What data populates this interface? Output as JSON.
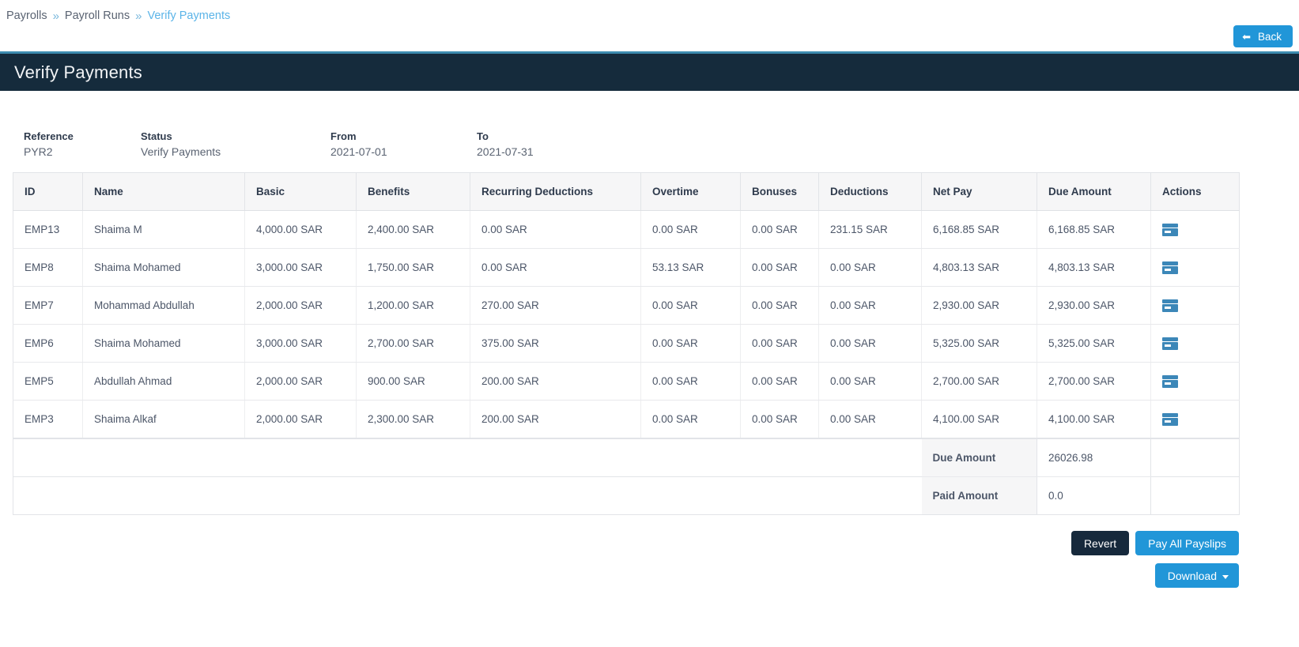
{
  "breadcrumb": {
    "items": [
      {
        "label": "Payrolls",
        "active": false
      },
      {
        "label": "Payroll Runs",
        "active": false
      },
      {
        "label": "Verify Payments",
        "active": true
      }
    ],
    "separator": "»"
  },
  "toolbar": {
    "back_label": "Back",
    "back_icon": "arrow-left-icon"
  },
  "header": {
    "title": "Verify Payments"
  },
  "meta": [
    {
      "label": "Reference",
      "value": "PYR2"
    },
    {
      "label": "Status",
      "value": "Verify Payments"
    },
    {
      "label": "From",
      "value": "2021-07-01"
    },
    {
      "label": "To",
      "value": "2021-07-31"
    }
  ],
  "table": {
    "columns": [
      "ID",
      "Name",
      "Basic",
      "Benefits",
      "Recurring Deductions",
      "Overtime",
      "Bonuses",
      "Deductions",
      "Net Pay",
      "Due Amount",
      "Actions"
    ],
    "rows": [
      {
        "id": "EMP13",
        "name": "Shaima M",
        "basic": "4,000.00 SAR",
        "benefits": "2,400.00 SAR",
        "recurring_deductions": "0.00 SAR",
        "overtime": "0.00 SAR",
        "bonuses": "0.00 SAR",
        "deductions": "231.15 SAR",
        "net_pay": "6,168.85 SAR",
        "due_amount": "6,168.85 SAR",
        "action_icon": "credit-card-icon"
      },
      {
        "id": "EMP8",
        "name": "Shaima Mohamed",
        "basic": "3,000.00 SAR",
        "benefits": "1,750.00 SAR",
        "recurring_deductions": "0.00 SAR",
        "overtime": "53.13 SAR",
        "bonuses": "0.00 SAR",
        "deductions": "0.00 SAR",
        "net_pay": "4,803.13 SAR",
        "due_amount": "4,803.13 SAR",
        "action_icon": "credit-card-icon"
      },
      {
        "id": "EMP7",
        "name": "Mohammad Abdullah",
        "basic": "2,000.00 SAR",
        "benefits": "1,200.00 SAR",
        "recurring_deductions": "270.00 SAR",
        "overtime": "0.00 SAR",
        "bonuses": "0.00 SAR",
        "deductions": "0.00 SAR",
        "net_pay": "2,930.00 SAR",
        "due_amount": "2,930.00 SAR",
        "action_icon": "credit-card-icon"
      },
      {
        "id": "EMP6",
        "name": "Shaima Mohamed",
        "basic": "3,000.00 SAR",
        "benefits": "2,700.00 SAR",
        "recurring_deductions": "375.00 SAR",
        "overtime": "0.00 SAR",
        "bonuses": "0.00 SAR",
        "deductions": "0.00 SAR",
        "net_pay": "5,325.00 SAR",
        "due_amount": "5,325.00 SAR",
        "action_icon": "credit-card-icon"
      },
      {
        "id": "EMP5",
        "name": "Abdullah Ahmad",
        "basic": "2,000.00 SAR",
        "benefits": "900.00 SAR",
        "recurring_deductions": "200.00 SAR",
        "overtime": "0.00 SAR",
        "bonuses": "0.00 SAR",
        "deductions": "0.00 SAR",
        "net_pay": "2,700.00 SAR",
        "due_amount": "2,700.00 SAR",
        "action_icon": "credit-card-icon"
      },
      {
        "id": "EMP3",
        "name": "Shaima Alkaf",
        "basic": "2,000.00 SAR",
        "benefits": "2,300.00 SAR",
        "recurring_deductions": "200.00 SAR",
        "overtime": "0.00 SAR",
        "bonuses": "0.00 SAR",
        "deductions": "0.00 SAR",
        "net_pay": "4,100.00 SAR",
        "due_amount": "4,100.00 SAR",
        "action_icon": "credit-card-icon"
      }
    ],
    "summary": [
      {
        "label": "Due Amount",
        "value": "26026.98"
      },
      {
        "label": "Paid Amount",
        "value": "0.0"
      }
    ]
  },
  "footer_actions": {
    "revert_label": "Revert",
    "pay_all_label": "Pay All Payslips",
    "download_label": "Download"
  },
  "colors": {
    "accent": "#2196d8",
    "header_bg": "#152b3c",
    "header_rule": "#3d8cb0",
    "dark_button": "#16293c",
    "icon_blue": "#3c87b8",
    "link": "#5bb4e8"
  }
}
